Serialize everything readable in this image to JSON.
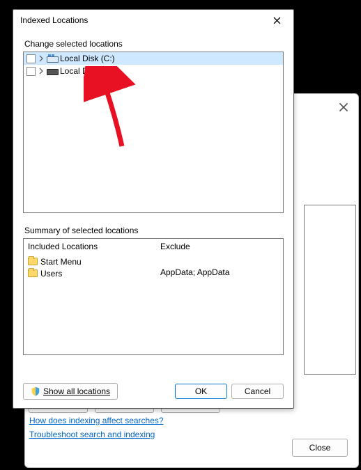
{
  "bg": {
    "link1": "How does indexing affect searches?",
    "link2": "Troubleshoot search and indexing",
    "close": "Close"
  },
  "dialog": {
    "title": "Indexed Locations",
    "change_label": "Change selected locations",
    "disks": {
      "c": "Local Disk (C:)",
      "e": "Local Disk (E:)"
    },
    "summary_label": "Summary of selected locations",
    "included_header": "Included Locations",
    "exclude_header": "Exclude",
    "included": {
      "start_menu": "Start Menu",
      "users": "Users"
    },
    "exclude_text": "AppData; AppData",
    "show_all": "Show all locations",
    "ok": "OK",
    "cancel": "Cancel"
  }
}
